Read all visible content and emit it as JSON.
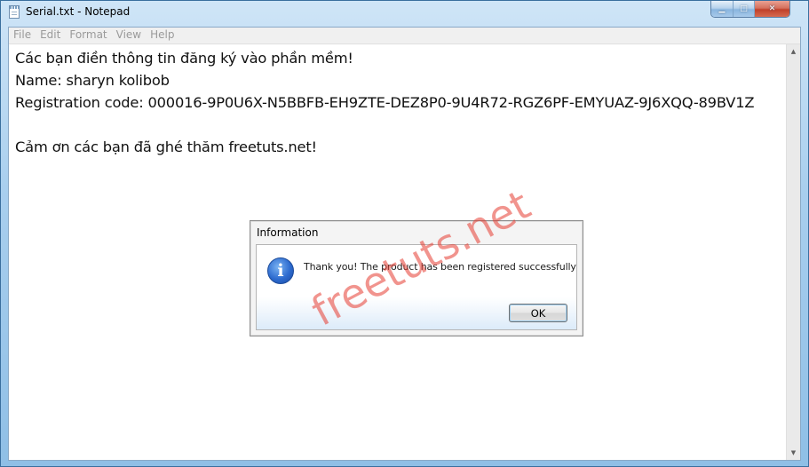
{
  "window": {
    "title": "Serial.txt - Notepad",
    "icon": "notepad-icon"
  },
  "caption_buttons": {
    "minimize_icon": "minimize-icon",
    "maximize_icon": "maximize-icon",
    "close_icon": "close-icon"
  },
  "menu": {
    "items": [
      "File",
      "Edit",
      "Format",
      "View",
      "Help"
    ]
  },
  "editor": {
    "lines": [
      "Các bạn điền thông tin đăng ký vào phần mềm!",
      "Name: sharyn kolibob",
      "Registration code: 000016-9P0U6X-N5BBFB-EH9ZTE-DEZ8P0-9U4R72-RGZ6PF-EMYUAZ-9J6XQQ-89BV1Z",
      "",
      "Cảm ơn các bạn đã ghé thăm freetuts.net!"
    ]
  },
  "dialog": {
    "title": "Information",
    "icon": "info-icon",
    "message": "Thank you! The product has been registered successfully",
    "ok_label": "OK"
  },
  "watermark": {
    "text": "freetuts.net",
    "color": "#e63c32"
  }
}
